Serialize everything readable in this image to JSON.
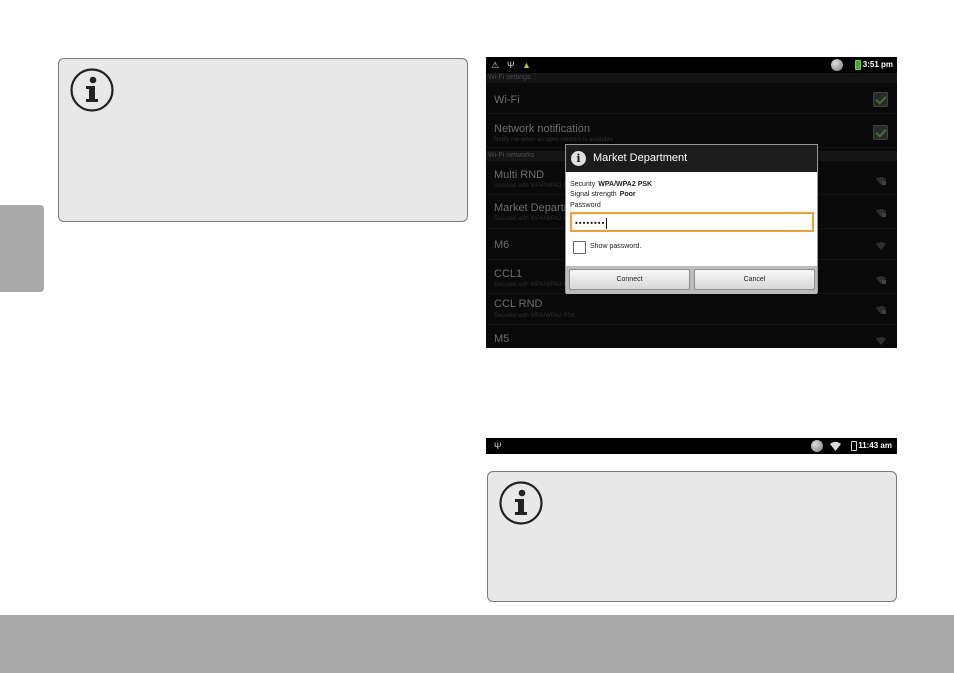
{
  "settings_screen": {
    "status_bar": {
      "left_icons": [
        "warning-icon",
        "usb-icon",
        "android-icon"
      ],
      "time": "3:51 pm",
      "battery_color": "#47a72d"
    },
    "section_wifi_settings": "Wi-Fi settings",
    "wifi_row": {
      "title": "Wi-Fi",
      "checked": true
    },
    "network_notification_row": {
      "title": "Network notification",
      "subtitle": "Notify me when an open network is available",
      "checked": true
    },
    "section_wifi_networks": "Wi-Fi networks",
    "networks": [
      {
        "name": "Multi RND",
        "security": "Secured with WPA/WPA2 PSK",
        "secured": true
      },
      {
        "name": "Market Department",
        "security": "Secured with WPA/WPA2 PSK",
        "secured": true
      },
      {
        "name": "M6",
        "security": "",
        "secured": false
      },
      {
        "name": "CCL1",
        "security": "Secured with WPA/WPA2 PSK",
        "secured": true
      },
      {
        "name": "CCL RND",
        "security": "Secured with WPA/WPA2 PSK",
        "secured": true
      },
      {
        "name": "M5",
        "security": "",
        "secured": false
      }
    ],
    "dialog": {
      "title": "Market Department",
      "security_label": "Security",
      "security_value": "WPA/WPA2 PSK",
      "signal_label": "Signal strength",
      "signal_value": "Poor",
      "password_label": "Password",
      "password_value": "••••••••",
      "show_password_label": "Show password.",
      "show_password_checked": false,
      "connect_label": "Connect",
      "cancel_label": "Cancel",
      "focus_color": "#f19f3a"
    }
  },
  "connected_status_bar": {
    "left_icons": [
      "usb-icon"
    ],
    "right_icons": [
      "globe-icon",
      "wifi-icon",
      "battery-icon"
    ],
    "time": "11:43 am"
  },
  "notes": [
    {
      "icon": "info-icon"
    },
    {
      "icon": "info-icon"
    }
  ]
}
